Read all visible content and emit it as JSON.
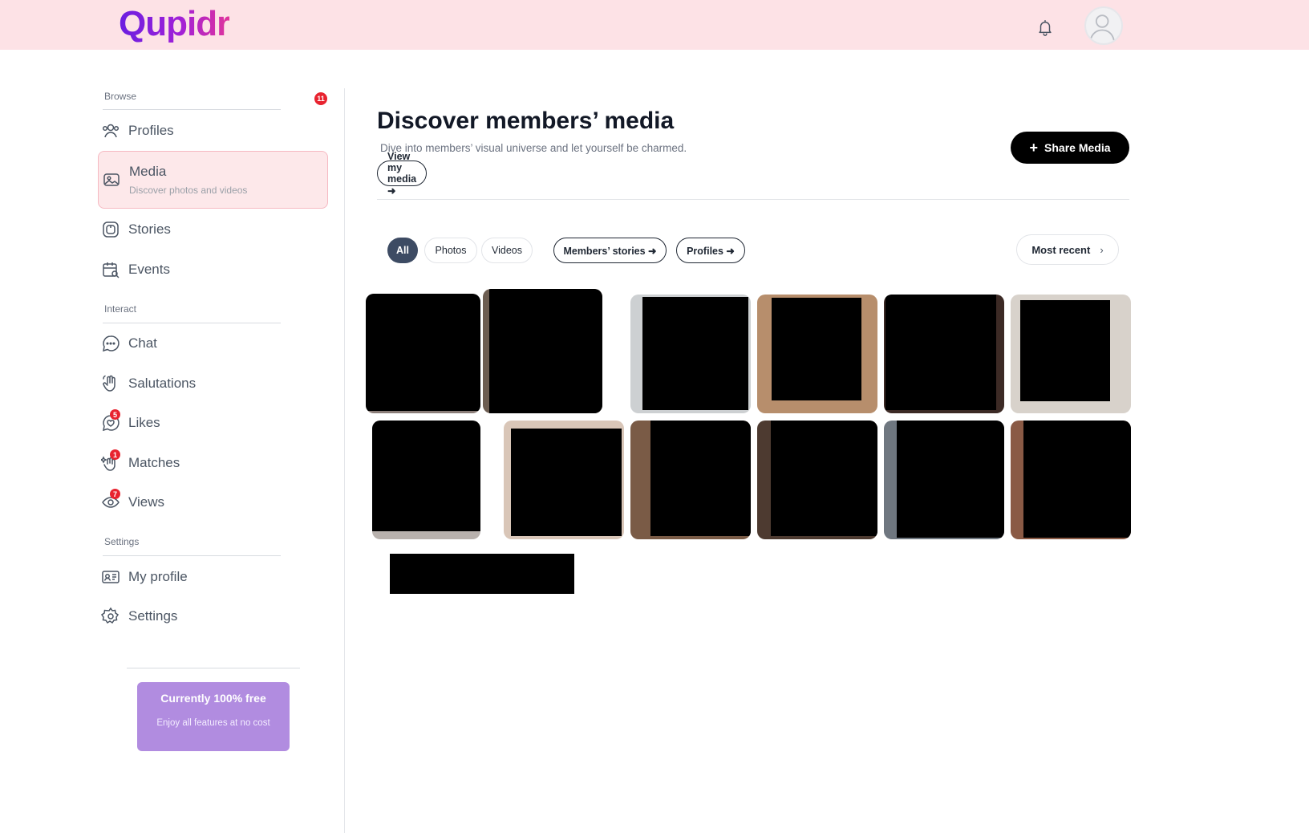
{
  "app": {
    "logo_text": "Qupidr",
    "accent_gradient": [
      "#6a1fe0",
      "#e0349c"
    ],
    "topbar_color": "#fde2e6"
  },
  "topbar": {
    "notifications_icon": "bell-icon",
    "avatar_icon": "avatar-placeholder-icon"
  },
  "sidebar": {
    "browse_label": "Browse",
    "browse_badge": "11",
    "interact_label": "Interact",
    "settings_label": "Settings",
    "items": [
      {
        "key": "profiles",
        "label": "Profiles",
        "icon": "users-icon"
      },
      {
        "key": "media",
        "label": "Media",
        "sub": "Discover photos and videos",
        "icon": "image-icon",
        "active": true
      },
      {
        "key": "stories",
        "label": "Stories",
        "icon": "stories-icon"
      },
      {
        "key": "events",
        "label": "Events",
        "icon": "calendar-icon"
      },
      {
        "key": "chat",
        "label": "Chat",
        "icon": "chat-bubble-icon"
      },
      {
        "key": "salutations",
        "label": "Salutations",
        "icon": "wave-hand-icon"
      },
      {
        "key": "likes",
        "label": "Likes",
        "icon": "heart-chat-icon",
        "badge": "5"
      },
      {
        "key": "matches",
        "label": "Matches",
        "icon": "sparkle-hand-icon",
        "badge": "1"
      },
      {
        "key": "views",
        "label": "Views",
        "icon": "eye-icon",
        "badge": "7"
      },
      {
        "key": "my_profile",
        "label": "My profile",
        "icon": "id-card-icon"
      },
      {
        "key": "settings",
        "label": "Settings",
        "icon": "gear-icon"
      }
    ],
    "promo": {
      "title": "Currently 100% free",
      "text": "Enjoy all features at no cost",
      "color": "#b18ce0"
    }
  },
  "main": {
    "title": "Discover members’ media",
    "subtitle": "Dive into members’ visual universe and let yourself be charmed.",
    "view_my_media": "View my media ➜",
    "share_media": "Share Media",
    "filters": [
      {
        "label": "All",
        "selected": true
      },
      {
        "label": "Photos"
      },
      {
        "label": "Videos"
      }
    ],
    "links": [
      "Members’ stories ➜",
      "Profiles ➜"
    ],
    "sort_label": "Most recent",
    "media_count": 12
  }
}
